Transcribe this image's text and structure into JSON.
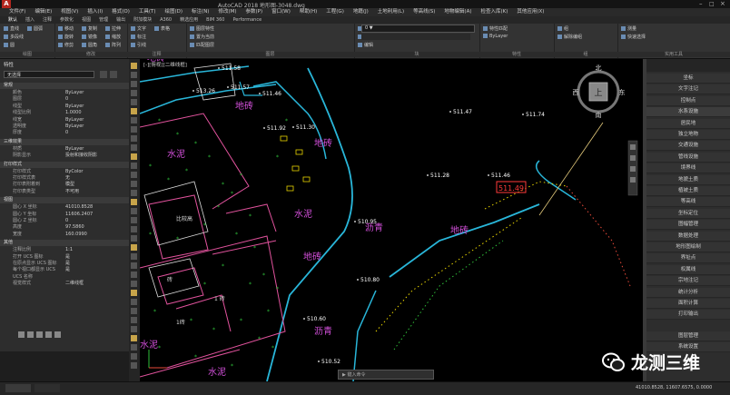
{
  "app": {
    "title": "AutoCAD 2018   地形图-3048.dwg",
    "logo_letter": "A"
  },
  "menus": [
    "文件(F)",
    "编辑(E)",
    "视图(V)",
    "插入(I)",
    "格式(O)",
    "工具(T)",
    "绘图(D)",
    "标注(N)",
    "修改(M)",
    "参数(P)",
    "窗口(W)",
    "帮助(H)",
    "工程(G)",
    "地籍(J)",
    "土地利用(L)",
    "等高线(S)",
    "地物编辑(A)",
    "检查入库(K)",
    "其他应用(X)"
  ],
  "ribbon_tabs": [
    "默认",
    "插入",
    "注释",
    "参数化",
    "视图",
    "管理",
    "输出",
    "附加模块",
    "A360",
    "精选应用",
    "BIM 360",
    "Performance"
  ],
  "ribbon_groups": [
    {
      "label": "绘图",
      "buttons": [
        "直线",
        "多段线",
        "圆",
        "圆弧"
      ]
    },
    {
      "label": "修改",
      "buttons": [
        "移动",
        "旋转",
        "修剪",
        "复制",
        "镜像",
        "圆角",
        "拉伸",
        "缩放",
        "阵列"
      ]
    },
    {
      "label": "注释",
      "buttons": [
        "文字",
        "标注",
        "引线",
        "表格"
      ]
    },
    {
      "label": "图层",
      "buttons": [
        "图层特性",
        "置为当前",
        "匹配图层"
      ]
    },
    {
      "label": "块",
      "buttons": [
        "插入",
        "创建",
        "编辑"
      ]
    },
    {
      "label": "特性",
      "buttons": [
        "特性匹配",
        "ByLayer"
      ]
    },
    {
      "label": "组",
      "buttons": [
        "组",
        "解除编组"
      ]
    },
    {
      "label": "实用工具",
      "buttons": [
        "测量",
        "快速选择"
      ]
    }
  ],
  "layer_dropdown": "0",
  "properties_panel": {
    "title": "特性",
    "selector": "无选择",
    "sections": [
      {
        "name": "常规",
        "rows": [
          [
            "颜色",
            "ByLayer"
          ],
          [
            "图层",
            "0"
          ],
          [
            "线型",
            "ByLayer"
          ],
          [
            "线型比例",
            "1.0000"
          ],
          [
            "线宽",
            "ByLayer"
          ],
          [
            "透明度",
            "ByLayer"
          ],
          [
            "厚度",
            "0"
          ]
        ]
      },
      {
        "name": "三维效果",
        "rows": [
          [
            "材质",
            "ByLayer"
          ],
          [
            "阴影显示",
            "投射和接收阴影"
          ]
        ]
      },
      {
        "name": "打印样式",
        "rows": [
          [
            "打印样式",
            "ByColor"
          ],
          [
            "打印样式表",
            "无"
          ],
          [
            "打印表附着到",
            "模型"
          ],
          [
            "打印表类型",
            "不可用"
          ]
        ]
      },
      {
        "name": "视图",
        "rows": [
          [
            "圆心 X 坐标",
            "41010.8528"
          ],
          [
            "圆心 Y 坐标",
            "11606.2407"
          ],
          [
            "圆心 Z 坐标",
            "0"
          ],
          [
            "高度",
            "97.5860"
          ],
          [
            "宽度",
            "160.0990"
          ]
        ]
      },
      {
        "name": "其他",
        "rows": [
          [
            "注释比例",
            "1:1"
          ],
          [
            "打开 UCS 图标",
            "是"
          ],
          [
            "在原点显示 UCS 图标",
            "是"
          ],
          [
            "每个视口都显示 UCS",
            "是"
          ],
          [
            "UCS 名称",
            ""
          ],
          [
            "视觉样式",
            "二维线框"
          ]
        ]
      }
    ]
  },
  "canvas": {
    "viewport_label": "[-][俯视][二维线框]",
    "elevations": [
      {
        "text": "511.58"
      },
      {
        "text": "513.26"
      },
      {
        "text": "511.57"
      },
      {
        "text": "511.46"
      },
      {
        "text": "511.47"
      },
      {
        "text": "511.74"
      },
      {
        "text": "511.92"
      },
      {
        "text": "511.30"
      },
      {
        "text": "511.28"
      },
      {
        "text": "511.46"
      },
      {
        "text": "510.95"
      },
      {
        "text": "510.80"
      },
      {
        "text": "510.60"
      },
      {
        "text": "510.52"
      }
    ],
    "highlight_label": "511.49",
    "material_labels": [
      {
        "text": "地砖"
      },
      {
        "text": "地砖"
      },
      {
        "text": "水泥"
      },
      {
        "text": "水泥"
      },
      {
        "text": "地砖"
      },
      {
        "text": "沥青"
      },
      {
        "text": "地砖"
      },
      {
        "text": "地砖"
      },
      {
        "text": "沥青"
      },
      {
        "text": "水泥"
      },
      {
        "text": "水泥"
      }
    ],
    "building_labels": [
      "比较高",
      "砖",
      "1 砖",
      "1砖"
    ],
    "compass": {
      "north": "北",
      "south": "南",
      "east": "东",
      "west": "西",
      "center": "上"
    },
    "colors": {
      "road": "#29b6d9",
      "building": "#e0529c",
      "elevation": "#ffffff",
      "material": "#d14fd8",
      "tree": "#2fbf3a",
      "highlight": "#ff3a3a",
      "yellow": "#e8d400"
    }
  },
  "right_panel": {
    "items": [
      "坐标",
      "文字注记",
      "控制点",
      "水系设施",
      "居民地",
      "独立地物",
      "交通设施",
      "管线设施",
      "境界线",
      "地貌土质",
      "植被土质",
      "等高线",
      "坐标定位",
      "图幅管理",
      "数据处理",
      "地形图绘制",
      "界址点",
      "权属线",
      "宗地注记",
      "统计分析",
      "面积计算",
      "打印输出"
    ],
    "selected_index": 3,
    "footer": [
      "图层管理",
      "系统设置"
    ]
  },
  "command_line": "键入命令",
  "status_coords": "41010.8528, 11607.6575, 0.0000",
  "watermark": "龙测三维"
}
